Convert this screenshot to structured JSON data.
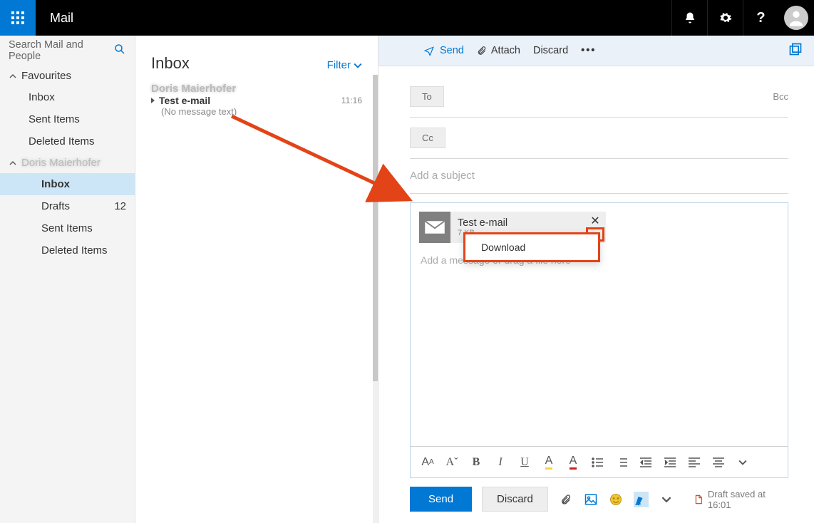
{
  "header": {
    "app_title": "Mail"
  },
  "search": {
    "placeholder": "Search Mail and People"
  },
  "sidebar": {
    "favourites_label": "Favourites",
    "fav_items": [
      "Inbox",
      "Sent Items",
      "Deleted Items"
    ],
    "account_label": "Doris Maierhofer",
    "folders": [
      {
        "label": "Inbox",
        "count": "",
        "active": true
      },
      {
        "label": "Drafts",
        "count": "12"
      },
      {
        "label": "Sent Items",
        "count": ""
      },
      {
        "label": "Deleted Items",
        "count": ""
      }
    ]
  },
  "msg_list": {
    "title": "Inbox",
    "filter": "Filter",
    "items": [
      {
        "sender": "Doris Maierhofer",
        "subject": "Test e-mail",
        "time": "11:16",
        "preview": "(No message text)"
      }
    ]
  },
  "compose": {
    "toolbar": {
      "send": "Send",
      "attach": "Attach",
      "discard": "Discard"
    },
    "to_label": "To",
    "cc_label": "Cc",
    "bcc_label": "Bcc",
    "subject_placeholder": "Add a subject",
    "body_placeholder": "Add a message or drag a file here",
    "attachment": {
      "name": "Test e-mail",
      "size": "7 KB",
      "menu_item": "Download"
    },
    "footer": {
      "send": "Send",
      "discard": "Discard",
      "draft_saved": "Draft saved at 16:01"
    }
  }
}
